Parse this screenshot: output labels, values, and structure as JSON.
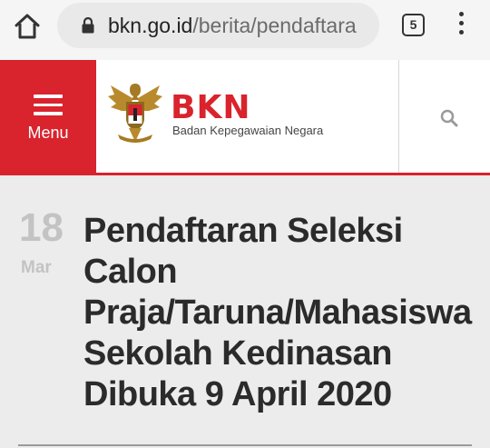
{
  "browser": {
    "url_domain": "bkn.go.id",
    "url_path": "/berita/pendaftara",
    "tab_count": "5"
  },
  "header": {
    "menu_label": "Menu",
    "brand": "BKN",
    "brand_subtitle": "Badan Kepegawaian Negara",
    "colors": {
      "brand_red": "#d9232d"
    }
  },
  "article": {
    "date_day": "18",
    "date_month": "Mar",
    "title": "Pendaftaran Seleksi Calon Praja/Taruna/Mahasiswa Sekolah Kedinasan Dibuka 9 April 2020"
  }
}
